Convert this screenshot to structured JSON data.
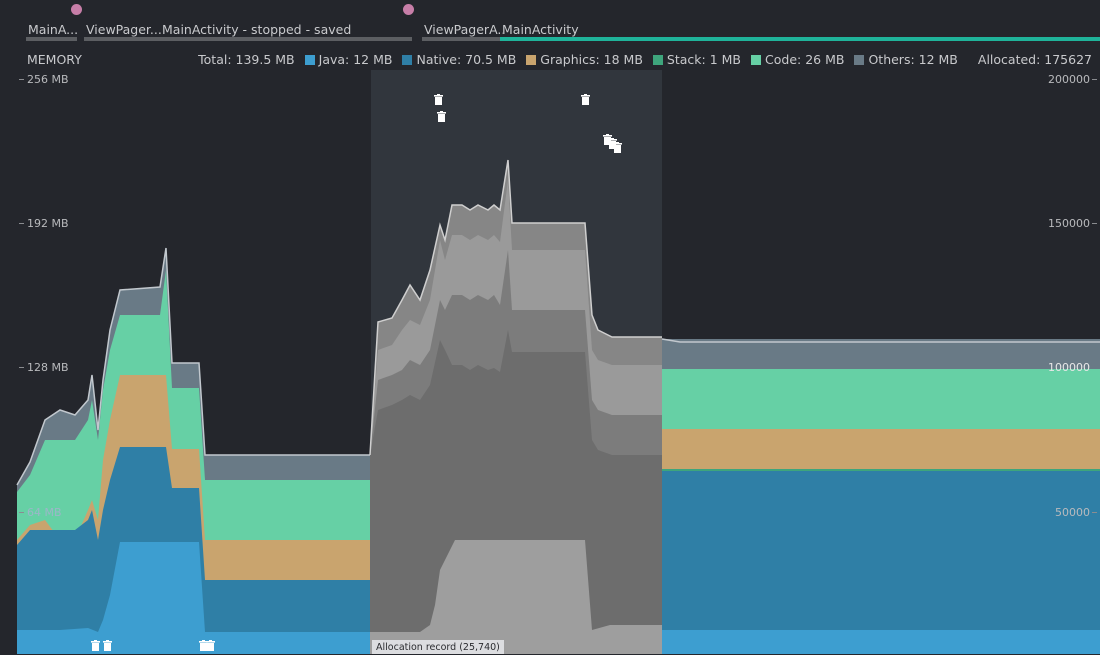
{
  "lifecycle": {
    "activities": [
      {
        "label": "MainA..."
      },
      {
        "label": "ViewPager..."
      },
      {
        "label": "MainActivity - stopped - saved"
      },
      {
        "label": "ViewPagerA..."
      },
      {
        "label": "MainActivity"
      }
    ]
  },
  "header": {
    "title": "MEMORY",
    "total": "Total: 139.5 MB",
    "legend": [
      {
        "label": "Java: 12 MB",
        "color": "#3d9ed0"
      },
      {
        "label": "Native: 70.5 MB",
        "color": "#2f7fa6"
      },
      {
        "label": "Graphics: 18 MB",
        "color": "#c9a46e"
      },
      {
        "label": "Stack: 1 MB",
        "color": "#3ea57c"
      },
      {
        "label": "Code: 26 MB",
        "color": "#66d0a5"
      },
      {
        "label": "Others: 12 MB",
        "color": "#697a86"
      }
    ],
    "allocated": "Allocated: 175627"
  },
  "axes": {
    "left": [
      "256 MB",
      "192 MB",
      "128 MB",
      "64 MB"
    ],
    "right": [
      "200000",
      "150000",
      "100000",
      "50000"
    ]
  },
  "selection": {
    "label": "Allocation record (25,740)"
  },
  "colors": {
    "background": "#24262c",
    "selection": "#31363d",
    "accent": "#1fb39a",
    "activity_dot": "#c77ea8"
  }
}
